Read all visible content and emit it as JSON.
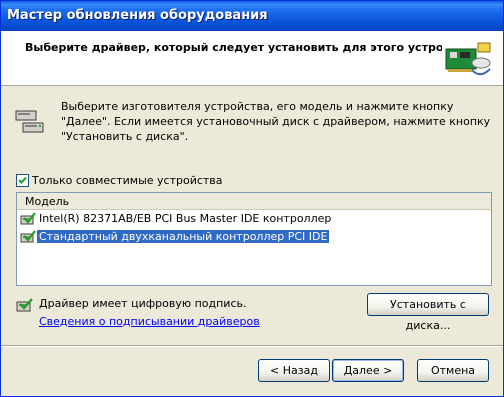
{
  "window": {
    "title": "Мастер обновления оборудования"
  },
  "header": {
    "title": "Выберите драйвер, который следует установить для этого устройства."
  },
  "instructions": {
    "text": "Выберите изготовителя устройства, его модель и нажмите кнопку \"Далее\". Если имеется установочный диск с  драйвером, нажмите кнопку \"Установить с диска\"."
  },
  "compatible_checkbox": {
    "label": "Только совместимые устройства",
    "checked": true
  },
  "model_list": {
    "column_header": "Модель",
    "items": [
      {
        "label": "Intel(R) 82371AB/EB PCI Bus Master IDE контроллер",
        "selected": false
      },
      {
        "label": "Стандартный двухканальный контроллер PCI IDE",
        "selected": true
      }
    ]
  },
  "signature": {
    "status_text": "Драйвер имеет цифровую подпись.",
    "link_text": "Сведения о подписывании драйверов"
  },
  "buttons": {
    "have_disk": "Установить с диска...",
    "back": "< Назад",
    "next": "Далее >",
    "cancel": "Отмена"
  },
  "colors": {
    "titlebar": "#0a54d8",
    "selection": "#316ac5",
    "link": "#0000ff",
    "dialog_bg": "#ece9d8"
  },
  "icons": {
    "header": "hardware-card-icon",
    "instructions": "devices-icon",
    "list_item": "signed-driver-icon",
    "signature": "signed-driver-icon"
  }
}
